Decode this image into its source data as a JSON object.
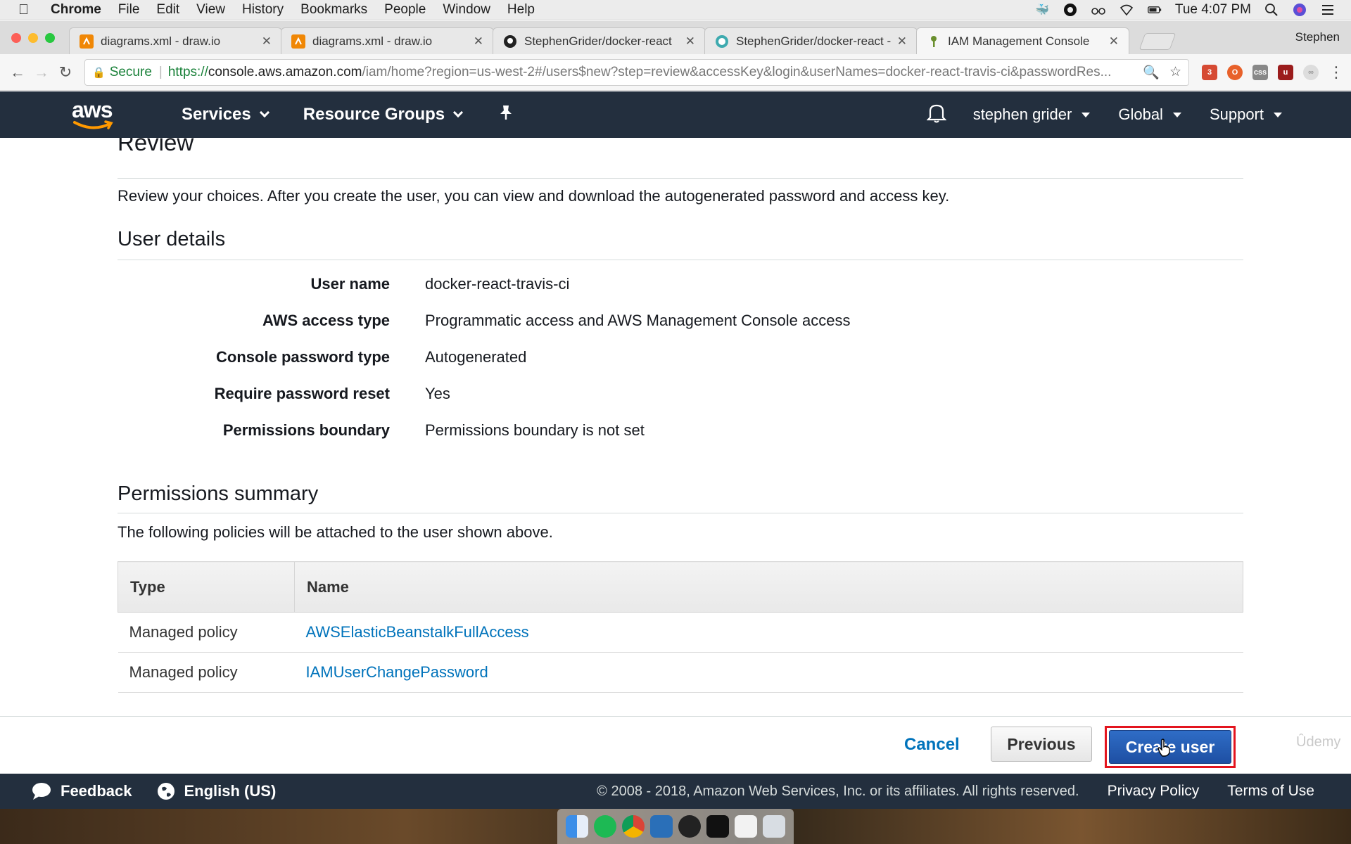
{
  "menubar": {
    "app": "Chrome",
    "items": [
      "File",
      "Edit",
      "View",
      "History",
      "Bookmarks",
      "People",
      "Window",
      "Help"
    ],
    "clock": "Tue 4:07 PM"
  },
  "tabs": [
    {
      "title": "diagrams.xml - draw.io",
      "icon": "drawio-icon",
      "color": "#f08705"
    },
    {
      "title": "diagrams.xml - draw.io",
      "icon": "drawio-icon",
      "color": "#f08705"
    },
    {
      "title": "StephenGrider/docker-react",
      "icon": "github-icon",
      "color": "#222222"
    },
    {
      "title": "StephenGrider/docker-react -",
      "icon": "travis-icon",
      "color": "#3eaaaf"
    },
    {
      "title": "IAM Management Console",
      "icon": "aws-key-icon",
      "color": "#6a8f2e"
    }
  ],
  "profile": "Stephen",
  "address": {
    "secure_label": "Secure",
    "url_prefix": "https://",
    "url_host": "console.aws.amazon.com",
    "url_rest": "/iam/home?region=us-west-2#/users$new?step=review&accessKey&login&userNames=docker-react-travis-ci&passwordRes..."
  },
  "aws_nav": {
    "logo": "aws",
    "services": "Services",
    "resource_groups": "Resource Groups",
    "user": "stephen grider",
    "region": "Global",
    "support": "Support"
  },
  "review": {
    "heading": "Review",
    "intro": "Review your choices. After you create the user, you can view and download the autogenerated password and access key.",
    "user_details_heading": "User details",
    "details": [
      {
        "label": "User name",
        "value": "docker-react-travis-ci"
      },
      {
        "label": "AWS access type",
        "value": "Programmatic access and AWS Management Console access"
      },
      {
        "label": "Console password type",
        "value": "Autogenerated"
      },
      {
        "label": "Require password reset",
        "value": "Yes"
      },
      {
        "label": "Permissions boundary",
        "value": "Permissions boundary is not set"
      }
    ],
    "permissions_heading": "Permissions summary",
    "permissions_intro": "The following policies will be attached to the user shown above.",
    "table_headers": [
      "Type",
      "Name"
    ],
    "policies": [
      {
        "type": "Managed policy",
        "name": "AWSElasticBeanstalkFullAccess"
      },
      {
        "type": "Managed policy",
        "name": "IAMUserChangePassword"
      }
    ]
  },
  "buttons": {
    "cancel": "Cancel",
    "previous": "Previous",
    "create": "Create user"
  },
  "watermark": "Ûdemy",
  "footer": {
    "feedback": "Feedback",
    "language": "English (US)",
    "copyright": "© 2008 - 2018, Amazon Web Services, Inc. or its affiliates. All rights reserved.",
    "privacy": "Privacy Policy",
    "terms": "Terms of Use"
  },
  "colors": {
    "aws_nav_bg": "#232f3e",
    "link_blue": "#0073bb",
    "primary_button": "#1e4fa3",
    "highlight_red": "#e3141e",
    "aws_orange": "#ff9900"
  }
}
